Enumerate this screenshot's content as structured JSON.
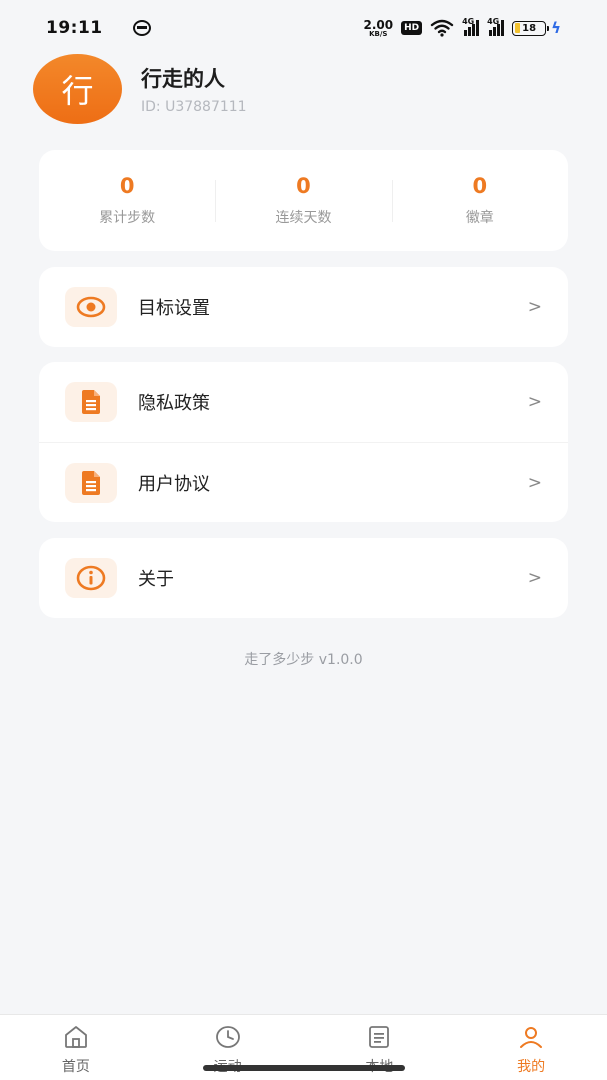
{
  "status_bar": {
    "time": "19:11",
    "net_speed": "2.00",
    "net_unit": "KB/S",
    "hd": "HD",
    "signal1": "4G",
    "signal2": "4G",
    "battery": "18"
  },
  "profile": {
    "avatar_char": "行",
    "name": "行走的人",
    "id": "ID: U37887111"
  },
  "stats": [
    {
      "value": "0",
      "label": "累计步数"
    },
    {
      "value": "0",
      "label": "连续天数"
    },
    {
      "value": "0",
      "label": "徽章"
    }
  ],
  "menu": {
    "goal": {
      "label": "目标设置",
      "icon": "eye-icon"
    },
    "privacy": {
      "label": "隐私政策",
      "icon": "document-icon"
    },
    "agreement": {
      "label": "用户协议",
      "icon": "document-icon"
    },
    "about": {
      "label": "关于",
      "icon": "info-icon"
    },
    "chevron": ">"
  },
  "version": "走了多少步 v1.0.0",
  "tabs": [
    {
      "label": "首页",
      "icon": "home-icon"
    },
    {
      "label": "运动",
      "icon": "clock-icon"
    },
    {
      "label": "本地",
      "icon": "list-icon"
    },
    {
      "label": "我的",
      "icon": "person-icon",
      "active": true
    }
  ],
  "colors": {
    "accent": "#EE7A22",
    "background": "#F5F6F8",
    "icon_bg": "#FDF1E7"
  }
}
